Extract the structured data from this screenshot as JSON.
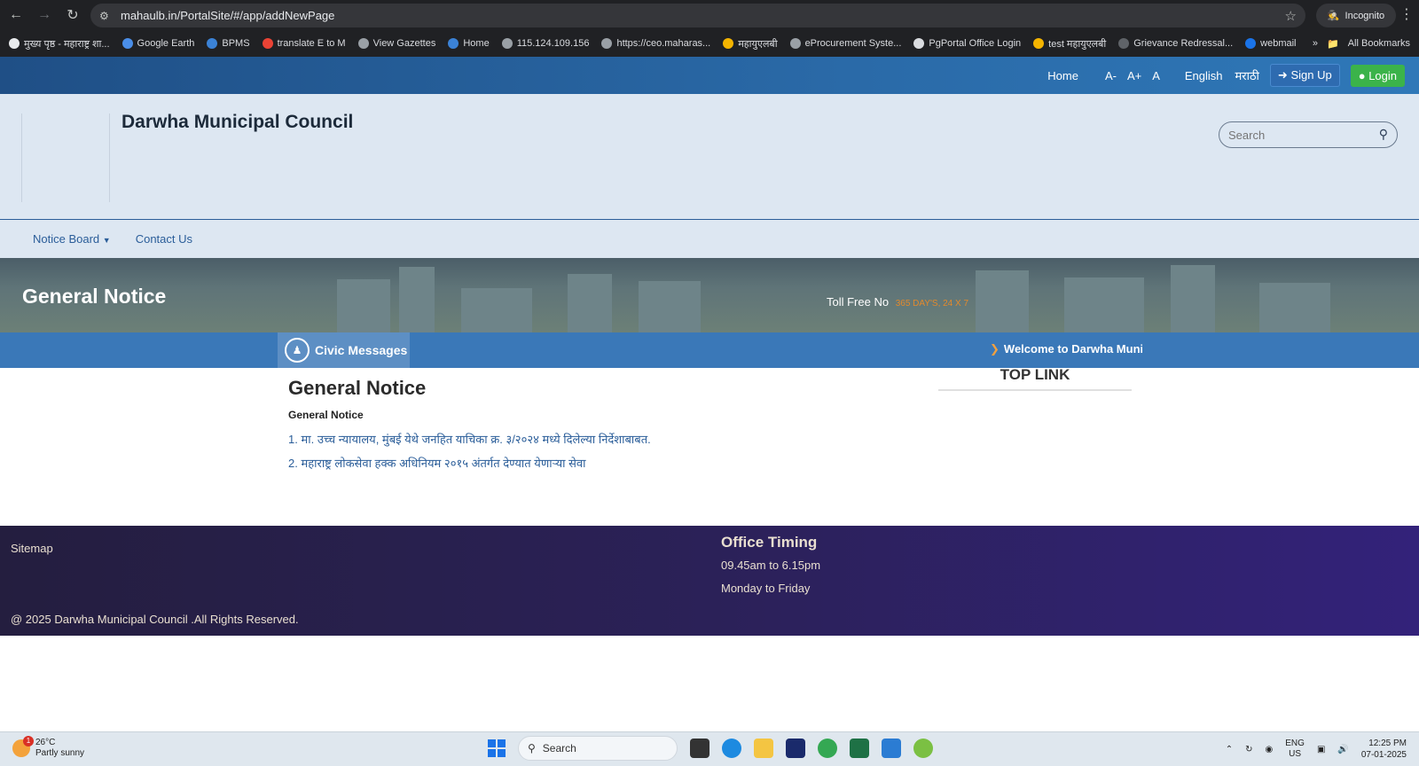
{
  "browser": {
    "url": "mahaulb.in/PortalSite/#/app/addNewPage",
    "incognito_label": "Incognito",
    "bookmarks": [
      {
        "label": "मुख्य पृष्ठ - महाराष्ट्र शा...",
        "color": "#e8eaed"
      },
      {
        "label": "Google Earth",
        "color": "#4a8ee8"
      },
      {
        "label": "BPMS",
        "color": "#3b82d6"
      },
      {
        "label": "translate E to M",
        "color": "#ea4335"
      },
      {
        "label": "View Gazettes",
        "color": "#9aa0a6"
      },
      {
        "label": "Home",
        "color": "#3b82d6"
      },
      {
        "label": "115.124.109.156",
        "color": "#9aa0a6"
      },
      {
        "label": "https://ceo.maharas...",
        "color": "#9aa0a6"
      },
      {
        "label": "महायुएलबी",
        "color": "#f4b400"
      },
      {
        "label": "eProcurement Syste...",
        "color": "#9aa0a6"
      },
      {
        "label": "PgPortal Office Login",
        "color": "#dadce0"
      },
      {
        "label": "test महायुएलबी",
        "color": "#f4b400"
      },
      {
        "label": "Grievance Redressal...",
        "color": "#5f6368"
      },
      {
        "label": "webmail",
        "color": "#1a73e8"
      }
    ],
    "all_bookmarks_label": "All Bookmarks"
  },
  "topbar": {
    "home": "Home",
    "font_decrease": "A-",
    "font_increase": "A+",
    "font_normal": "A",
    "lang_english": "English",
    "lang_marathi": "मराठी",
    "signup": "Sign Up",
    "login": "Login"
  },
  "header": {
    "site_title": "Darwha Municipal Council",
    "search_placeholder": "Search"
  },
  "menu": {
    "notice_board": "Notice Board",
    "contact_us": "Contact Us"
  },
  "banner": {
    "title": "General Notice",
    "toll_free_label": "Toll Free No",
    "toll_free_value": "365 DAY'S, 24 X 7"
  },
  "civic": {
    "label": "Civic Messages",
    "marquee": "Welcome to Darwha Municip"
  },
  "content": {
    "title": "General Notice",
    "subtitle": "General Notice",
    "notices": [
      "1. मा. उच्च न्यायालय, मुंबई येथे जनहित याचिका क्र. ३/२०२४ मध्ये दिलेल्या निर्देशाबाबत.",
      "2. महाराष्ट्र लोकसेवा हक्क अधिनियम २०१५ अंतर्गत देण्यात येणाऱ्या सेवा"
    ],
    "top_link": "TOP LINK"
  },
  "footer": {
    "sitemap": "Sitemap",
    "copyright": "@ 2025 Darwha Municipal Council .All Rights Reserved.",
    "timing_title": "Office Timing",
    "timing_hours": "09.45am to 6.15pm",
    "timing_days": "Monday to Friday"
  },
  "taskbar": {
    "weather_temp": "26°C",
    "weather_desc": "Partly sunny",
    "weather_badge": "1",
    "search_label": "Search",
    "lang_top": "ENG",
    "lang_bottom": "US",
    "time": "12:25 PM",
    "date": "07-01-2025"
  }
}
